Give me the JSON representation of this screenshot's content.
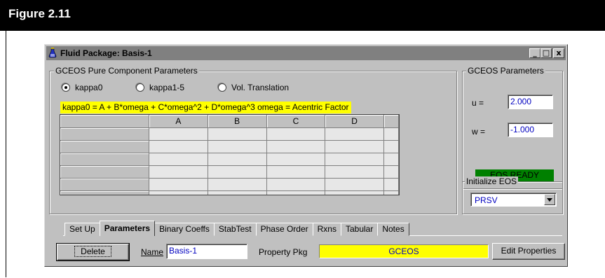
{
  "figure": {
    "label": "Figure 2.11"
  },
  "window": {
    "title": "Fluid Package: Basis-1",
    "controls": {
      "minimize": "_",
      "maximize": "□",
      "close": "x"
    }
  },
  "pure_component": {
    "group_title": "GCEOS Pure Component Parameters",
    "radios": [
      {
        "label": "kappa0",
        "selected": true
      },
      {
        "label": "kappa1-5",
        "selected": false
      },
      {
        "label": "Vol. Translation",
        "selected": false
      }
    ],
    "formula": "kappa0 = A + B*omega + C*omega^2 + D*omega^3    omega = Acentric Factor",
    "grid": {
      "columns": [
        "",
        "A",
        "B",
        "C",
        "D",
        ""
      ],
      "rows": 6
    }
  },
  "eos_params": {
    "group_title": "GCEOS Parameters",
    "u_label": "u =",
    "u_value": "2.000",
    "w_label": "w =",
    "w_value": "-1.000",
    "status": "EOS READY",
    "status_color": "#008000"
  },
  "initialize": {
    "group_title": "Initialize EOS",
    "selected": "PRSV"
  },
  "tabs": [
    "Set Up",
    "Parameters",
    "Binary Coeffs",
    "StabTest",
    "Phase Order",
    "Rxns",
    "Tabular",
    "Notes"
  ],
  "active_tab": "Parameters",
  "footer": {
    "delete_label": "Delete",
    "name_label": "Name",
    "name_value": "Basis-1",
    "property_pkg_label": "Property Pkg",
    "property_pkg_value": "GCEOS",
    "edit_label": "Edit Properties"
  }
}
